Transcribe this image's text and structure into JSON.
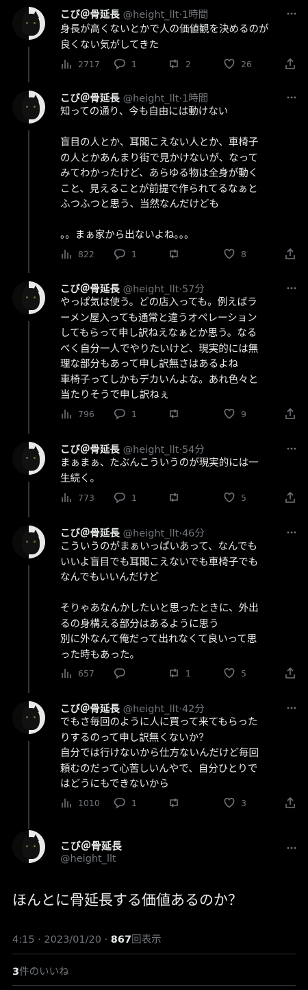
{
  "tweets": [
    {
      "name": "こび＠骨延長",
      "handle": "@height_llt",
      "time": "1時間",
      "text": "身長が高くないとかで人の価値観を決めるのが\n良くない気がしてきた",
      "views": "2717",
      "replies": "1",
      "retweets": "2",
      "likes": "26"
    },
    {
      "name": "こび＠骨延長",
      "handle": "@height_llt",
      "time": "1時間",
      "text": "知っての通り、今も自由には動けない\n\n盲目の人とか、耳聞こえない人とか、車椅子\nの人とかあんまり街で見かけないが、なって\nみてわかったけど、あらゆる物は全身が動く\nこと、見えることが前提で作られてるなぁと\nふつふつと思う、当然なんだけども\n\n。。まぁ家から出ないよね。。。",
      "views": "822",
      "replies": "1",
      "retweets": "",
      "likes": "8"
    },
    {
      "name": "こび＠骨延長",
      "handle": "@height_llt",
      "time": "57分",
      "text": "やっぱ気は使う。どの店入っても。例えばラ\nーメン屋入っても通常と違うオペレーション\nしてもらって申し訳ねえなぁとか思う。なる\nべく自分一人でやりたいけど、現実的には無\n理な部分もあって申し訳無さはあるよね\n車椅子ってしかもデカいんよな。あれ色々と\n当たりそうで申し訳ねぇ",
      "views": "796",
      "replies": "1",
      "retweets": "",
      "likes": "9"
    },
    {
      "name": "こび＠骨延長",
      "handle": "@height_llt",
      "time": "54分",
      "text": "まぁまぁ、たぶんこういうのが現実的には一\n生続く。",
      "views": "773",
      "replies": "1",
      "retweets": "",
      "likes": "5"
    },
    {
      "name": "こび＠骨延長",
      "handle": "@height_llt",
      "time": "46分",
      "text": "こういうのがまぁいっぱいあって、なんでも\nいいよ盲目でも耳聞こえないでも車椅子でも\nなんでもいいんだけど\n\nそりゃあなんかしたいと思ったときに、外出\nるの身構える部分はあるように思う\n別に外なんて俺だって出れなくて良いって思\nった時もあった。",
      "views": "657",
      "replies": "",
      "retweets": "1",
      "likes": "5"
    },
    {
      "name": "こび＠骨延長",
      "handle": "@height_llt",
      "time": "42分",
      "text": "でもさ毎回のように人に買って来てもらった\nりするのって申し訳無くないか？\n自分では行けないから仕方ないんだけど毎回\n頼むのだって心苦しいんやで、自分ひとりで\nはどうにもできないから",
      "views": "1010",
      "replies": "1",
      "retweets": "",
      "likes": "3"
    }
  ],
  "main": {
    "name": "こび＠骨延長",
    "handle": "@height_llt",
    "text": "ほんとに骨延長する価値あるのか？",
    "time": "4:15",
    "date": "2023/01/20",
    "views": "867",
    "views_label": "回表示",
    "likes_count": "3",
    "likes_label": "件のいいね"
  },
  "separator": "·",
  "colors": {
    "background": "#000000",
    "text": "#e7e9ea",
    "muted": "#71767b",
    "line": "#333639"
  }
}
